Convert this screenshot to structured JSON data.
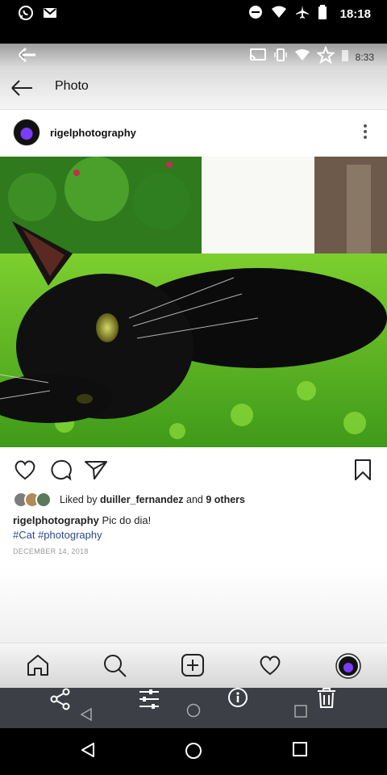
{
  "status_bar": {
    "time": "18:18",
    "left_icons": [
      "whatsapp-icon",
      "gmail-icon"
    ],
    "right_icons": [
      "do-not-disturb-icon",
      "wifi-icon",
      "airplane-icon",
      "battery-icon"
    ]
  },
  "viewer_bar": {
    "time": "8:33",
    "icons": [
      "back-arrow-icon",
      "cast-icon",
      "vibrate-icon",
      "wifi-icon",
      "star-icon",
      "battery-icon"
    ]
  },
  "header": {
    "title": "Photo"
  },
  "post": {
    "username": "rigelphotography",
    "liked_by_prefix": "Liked by",
    "liked_by_user": "duiller_fernandez",
    "liked_by_mid": "and",
    "liked_by_count": "9 others",
    "caption_user": "rigelphotography",
    "caption_text": " Pic do dia!",
    "tags": "#Cat #photography",
    "date": "DECEMBER 14, 2018"
  },
  "actions": [
    "heart-icon",
    "comment-icon",
    "send-icon",
    "bookmark-icon"
  ],
  "bottom_nav": [
    "home-icon",
    "search-icon",
    "add-icon",
    "heart-icon",
    "profile-avatar"
  ],
  "overlay_actions": [
    "share-icon",
    "edit-icon",
    "info-icon",
    "delete-icon"
  ],
  "colors": {
    "accent_purple": "#7a3cff",
    "tag_blue": "#2a4a8a",
    "overlay_bg": "#3c3f45"
  }
}
